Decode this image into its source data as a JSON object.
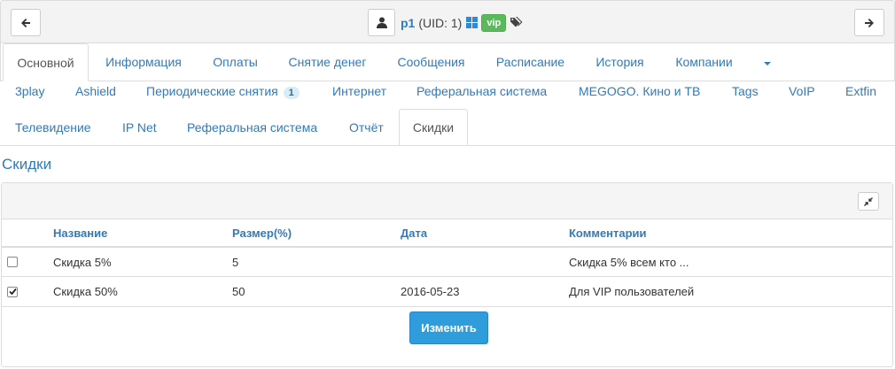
{
  "user": {
    "login": "p1",
    "uid_text": "(UID: 1)",
    "vip_badge": "vip",
    "icons": [
      "arrow-left-icon",
      "user-icon",
      "windows-icon",
      "tags-icon",
      "arrow-right-icon"
    ]
  },
  "main_tabs": [
    {
      "label": "Основной",
      "active": true
    },
    {
      "label": "Информация"
    },
    {
      "label": "Оплаты"
    },
    {
      "label": "Снятие денег"
    },
    {
      "label": "Сообщения"
    },
    {
      "label": "Расписание"
    },
    {
      "label": "История"
    },
    {
      "label": "Компании"
    }
  ],
  "sub_tabs": [
    {
      "label": "3play"
    },
    {
      "label": "Ashield"
    },
    {
      "label": "Периодические снятия",
      "badge": "1"
    },
    {
      "label": "Интернет"
    },
    {
      "label": "Реферальная система"
    },
    {
      "label": "MEGOGO. Кино и ТВ"
    },
    {
      "label": "Tags"
    },
    {
      "label": "VoIP"
    },
    {
      "label": "Extfin"
    },
    {
      "label": "Телевидение"
    },
    {
      "label": "IP Net"
    },
    {
      "label": "Реферальная система"
    },
    {
      "label": "Отчёт"
    },
    {
      "label": "Скидки",
      "active": true
    }
  ],
  "section_title": "Скидки",
  "table": {
    "headers": [
      "Название",
      "Размер(%)",
      "Дата",
      "Комментарии"
    ],
    "rows": [
      {
        "checked": false,
        "name": "Скидка 5%",
        "size": "5",
        "date": "",
        "comment": "Скидка 5% всем кто ..."
      },
      {
        "checked": true,
        "name": "Скидка 50%",
        "size": "50",
        "date": "2016-05-23",
        "comment": "Для VIP пользователей"
      }
    ]
  },
  "submit_label": "Изменить",
  "colors": {
    "link": "#337ab7",
    "vip": "#5cb85c",
    "primary_button": "#2f9ddb"
  }
}
